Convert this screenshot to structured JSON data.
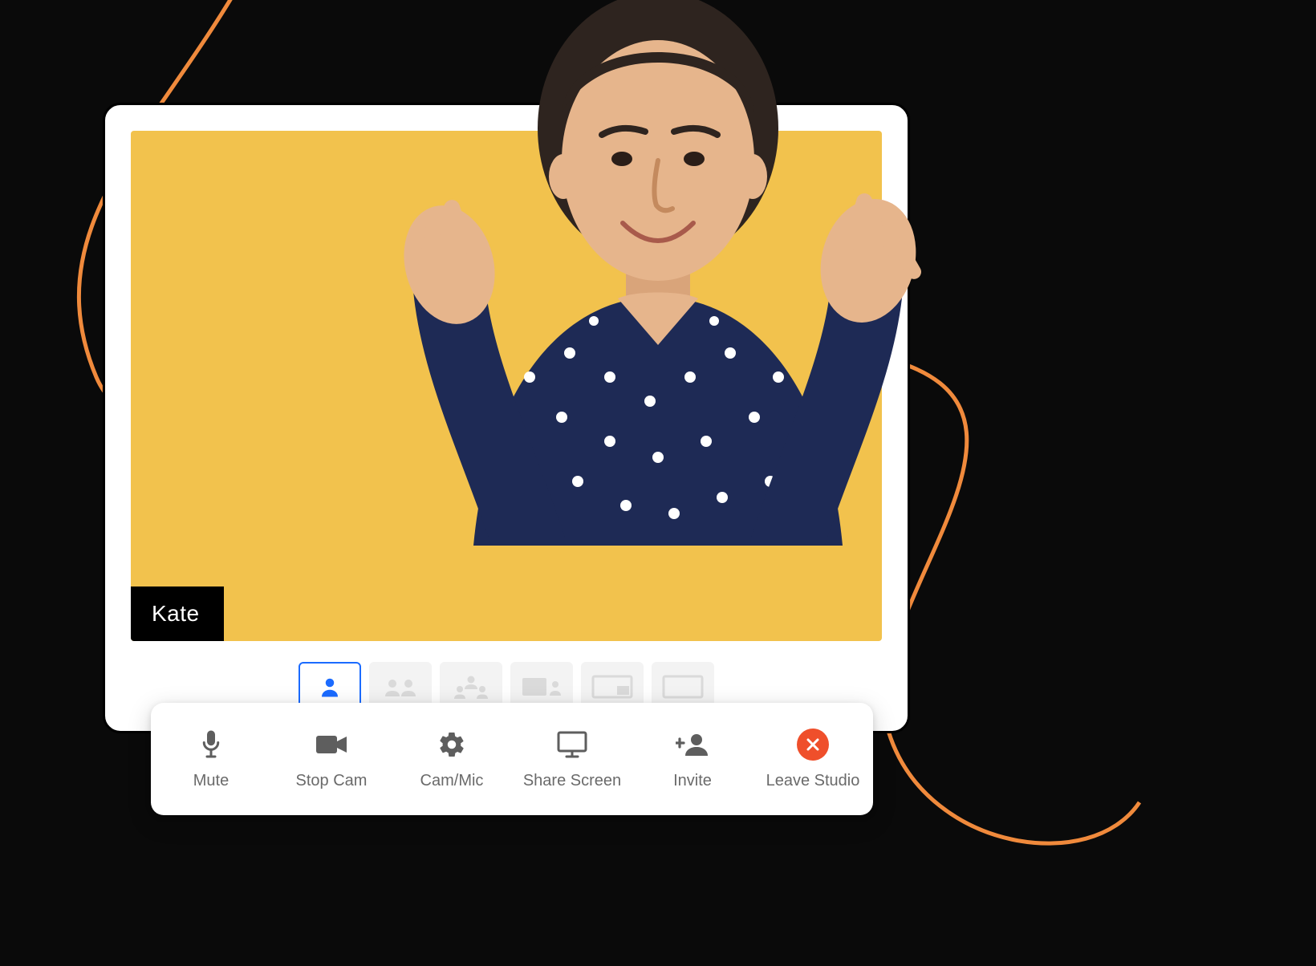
{
  "participant": {
    "name": "Kate"
  },
  "layout_options": [
    {
      "id": "single",
      "active": true
    },
    {
      "id": "two-up",
      "active": false
    },
    {
      "id": "three-up",
      "active": false
    },
    {
      "id": "screen-thumb",
      "active": false
    },
    {
      "id": "pip",
      "active": false
    },
    {
      "id": "full",
      "active": false
    }
  ],
  "toolbar": {
    "mute": {
      "label": "Mute"
    },
    "cam": {
      "label": "Stop Cam"
    },
    "device": {
      "label": "Cam/Mic"
    },
    "share": {
      "label": "Share Screen"
    },
    "invite": {
      "label": "Invite"
    },
    "leave": {
      "label": "Leave Studio"
    }
  },
  "colors": {
    "accent": "#1B6BFF",
    "video_bg": "#F2C24D",
    "leave": "#EF4F2B",
    "swoosh": "#F08A3C"
  }
}
